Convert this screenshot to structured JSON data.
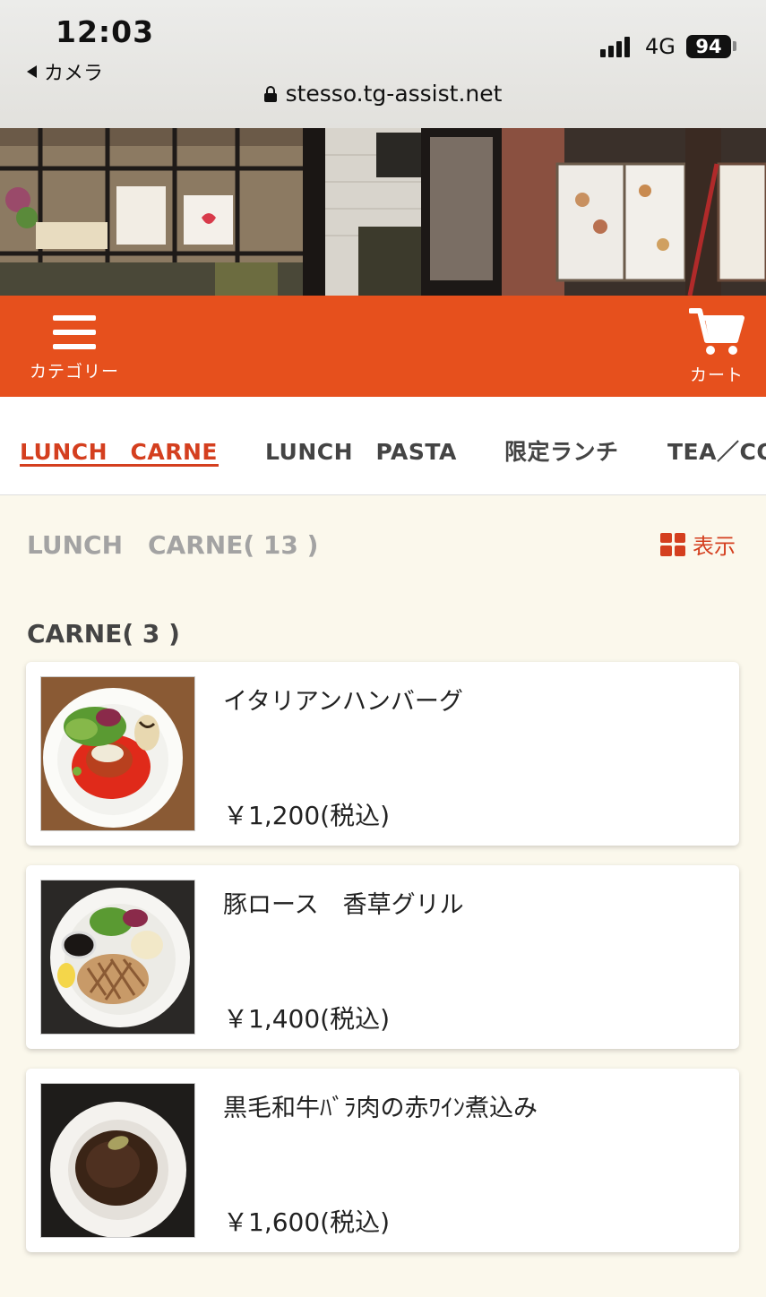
{
  "status": {
    "time": "12:03",
    "back_app": "カメラ",
    "network": "4G",
    "battery": "94",
    "url": "stesso.tg-assist.net"
  },
  "header": {
    "menu_label": "カテゴリー",
    "cart_label": "カート",
    "color": "#e6501d"
  },
  "tabs": [
    {
      "label": "LUNCH　CARNE",
      "active": true
    },
    {
      "label": "LUNCH　PASTA",
      "active": false
    },
    {
      "label": "限定ランチ",
      "active": false
    },
    {
      "label": "TEA／CO",
      "active": false
    }
  ],
  "category": {
    "title": "LUNCH　CARNE( 13 )",
    "view_label": "表示",
    "subcategory": "CARNE( 3 )"
  },
  "items": [
    {
      "name": "イタリアンハンバーグ",
      "price": "￥1,200(税込)",
      "photo": "hamburg-steak-plate"
    },
    {
      "name": "豚ロース　香草グリル",
      "price": "￥1,400(税込)",
      "photo": "grilled-pork-plate"
    },
    {
      "name": "黒毛和牛ﾊﾞﾗ肉の赤ﾜｲﾝ煮込み",
      "price": "￥1,600(税込)",
      "photo": "braised-beef-plate"
    }
  ],
  "colors": {
    "accent": "#d43f1f",
    "background": "#fbf8ec"
  }
}
